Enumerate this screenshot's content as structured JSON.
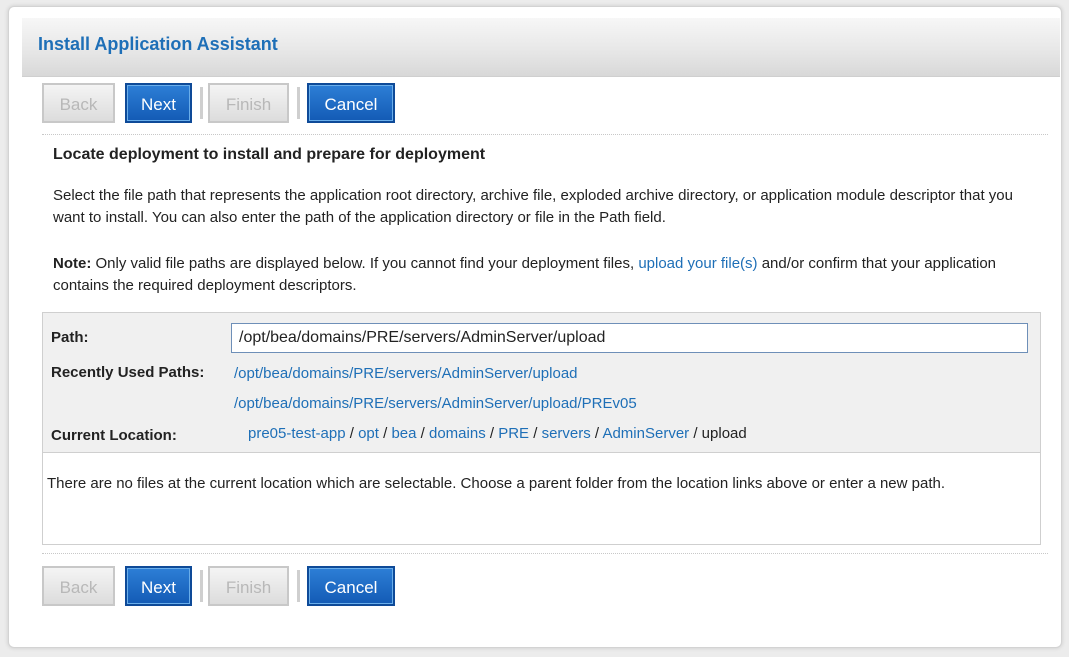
{
  "header": {
    "title": "Install Application Assistant"
  },
  "buttons": {
    "back": "Back",
    "next": "Next",
    "finish": "Finish",
    "cancel": "Cancel"
  },
  "content": {
    "heading": "Locate deployment to install and prepare for deployment",
    "description": "Select the file path that represents the application root directory, archive file, exploded archive directory, or application module descriptor that you want to install. You can also enter the path of the application directory or file in the Path field.",
    "note_label": "Note:",
    "note_text_before": " Only valid file paths are displayed below. If you cannot find your deployment files, ",
    "note_link": "upload your file(s)",
    "note_text_after": " and/or confirm that your application contains the required deployment descriptors."
  },
  "path": {
    "label": "Path:",
    "value": "/opt/bea/domains/PRE/servers/AdminServer/upload"
  },
  "recent": {
    "label": "Recently Used Paths:",
    "items": [
      "/opt/bea/domains/PRE/servers/AdminServer/upload",
      "/opt/bea/domains/PRE/servers/AdminServer/upload/PREv05"
    ]
  },
  "current": {
    "label": "Current Location:",
    "crumbs": [
      "pre05-test-app",
      "opt",
      "bea",
      "domains",
      "PRE",
      "servers",
      "AdminServer"
    ],
    "separator": " / ",
    "last": "upload"
  },
  "message": "There are no files at the current location which are selectable. Choose a parent folder from the location links above or enter a new path.",
  "colors": {
    "link": "#1e6fb7",
    "primary_button": "#1a66c4",
    "title": "#1e6fb7"
  }
}
